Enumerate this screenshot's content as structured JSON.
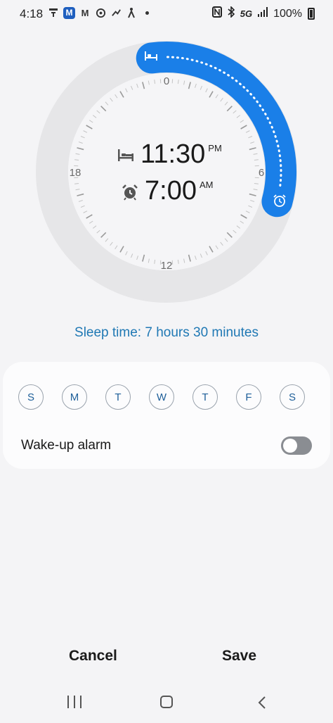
{
  "status_bar": {
    "time": "4:18",
    "left_icons": [
      "notification-icon",
      "m-app-icon",
      "gmail-icon",
      "sync-icon",
      "share-icon",
      "accessibility-icon"
    ],
    "right_icons": [
      "nfc-icon",
      "bluetooth-icon",
      "signal-icon",
      "battery-icon"
    ],
    "network": "5G",
    "battery": "100%"
  },
  "dial": {
    "labels": {
      "top": "0",
      "right": "6",
      "bottom": "12",
      "left": "18"
    },
    "bedtime": {
      "time": "11:30",
      "ampm": "PM",
      "icon": "bed-icon"
    },
    "wake": {
      "time": "7:00",
      "ampm": "AM",
      "icon": "alarm-clock-icon"
    },
    "accent_color": "#1a7fe8",
    "track_color": "#e6e6e8"
  },
  "sleep_time": "Sleep time: 7 hours 30 minutes",
  "days": [
    "S",
    "M",
    "T",
    "W",
    "T",
    "F",
    "S"
  ],
  "wake_alarm": {
    "label": "Wake-up alarm",
    "enabled": false
  },
  "actions": {
    "cancel": "Cancel",
    "save": "Save"
  },
  "nav_bar": {
    "icons": [
      "recent-apps-icon",
      "home-icon",
      "back-icon"
    ]
  }
}
